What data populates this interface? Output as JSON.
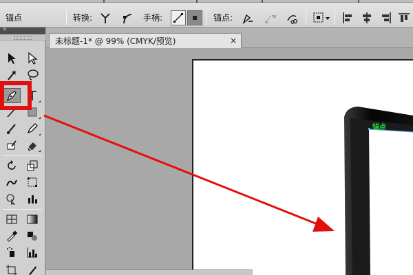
{
  "control_bar": {
    "anchor_label": "锚点",
    "convert_label": "转换:",
    "handles_label": "手柄:",
    "anchors_label": "锚点:"
  },
  "document": {
    "tab_title": "未标题-1* @ 99% (CMYK/预览)",
    "close_glyph": "×",
    "canvas_anchor_label": "锚点"
  },
  "toolbox": {
    "collapse_glyph": "«"
  },
  "colors": {
    "highlight_red": "#e01010",
    "anchor_green": "#18d83a"
  }
}
